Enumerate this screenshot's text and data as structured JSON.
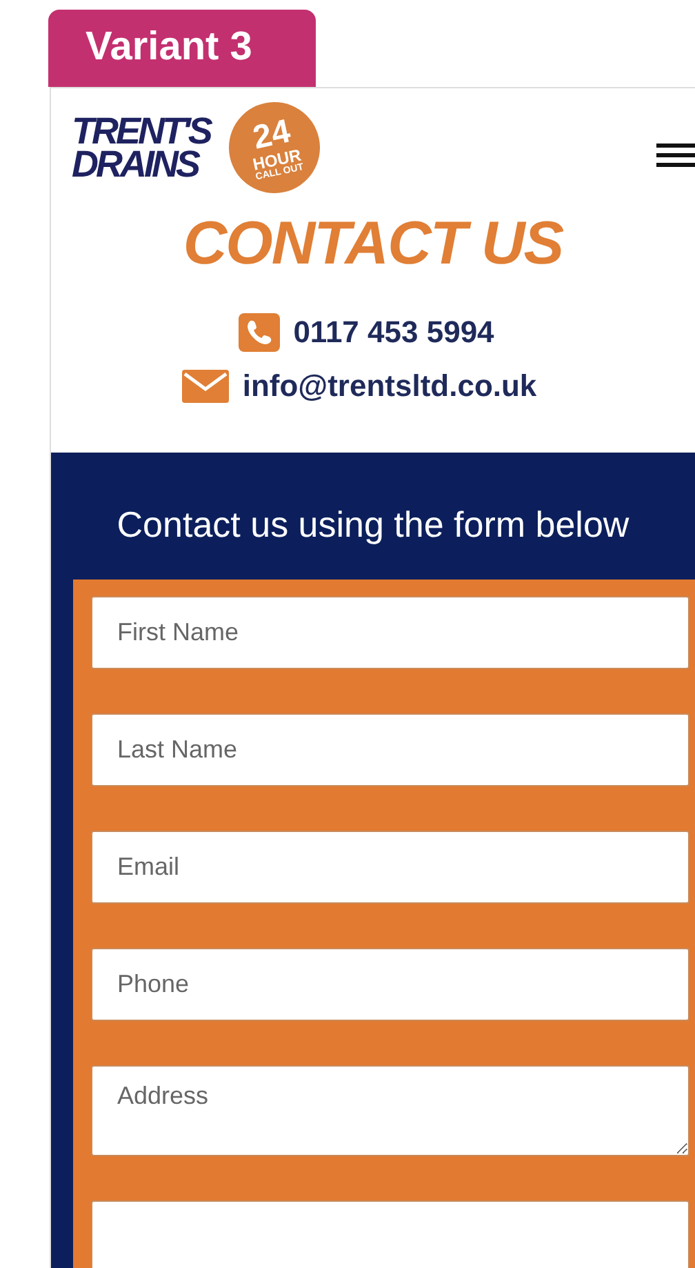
{
  "badge": {
    "label": "Variant 3"
  },
  "header": {
    "logo": {
      "line_1": "TRENT'S",
      "line_2": "DRAINS",
      "seal_number": "24",
      "seal_word": "HOUR",
      "seal_caption": "CALL OUT"
    }
  },
  "hero": {
    "title": "CONTACT US",
    "phone": "0117 453 5994",
    "email": "info@trentsltd.co.uk"
  },
  "form": {
    "heading": "Contact us using the form below",
    "fields": [
      {
        "kind": "input",
        "placeholder": "First Name"
      },
      {
        "kind": "input",
        "placeholder": "Last Name"
      },
      {
        "kind": "input",
        "placeholder": "Email"
      },
      {
        "kind": "input",
        "placeholder": "Phone"
      },
      {
        "kind": "textarea",
        "placeholder": "Address"
      },
      {
        "kind": "input"
      }
    ]
  }
}
